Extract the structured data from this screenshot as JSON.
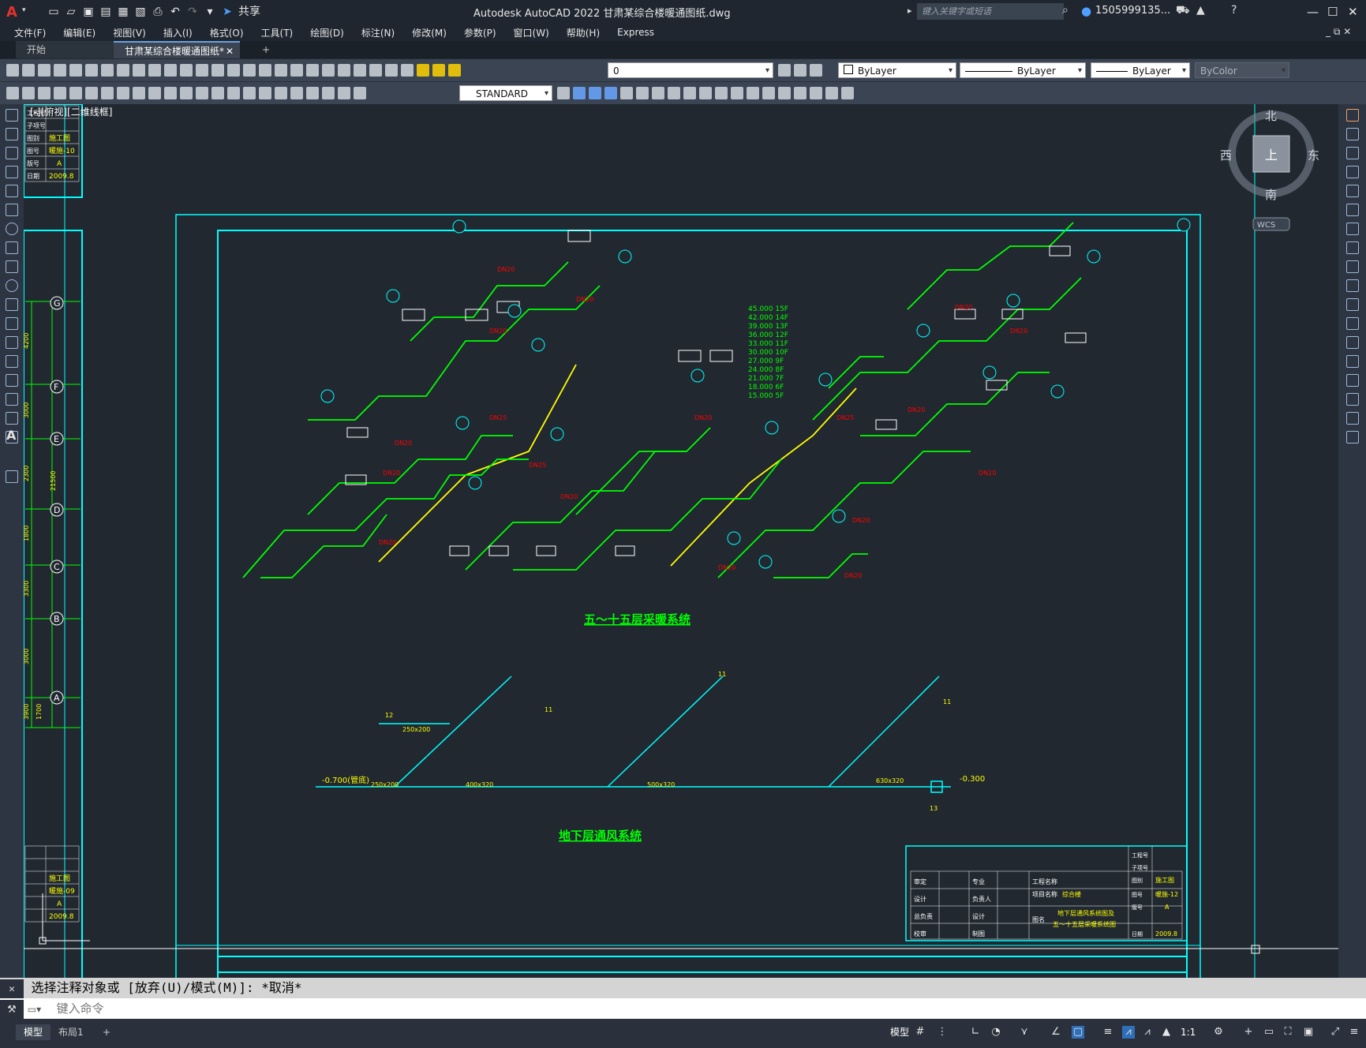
{
  "app": {
    "logo": "A",
    "title": "Autodesk AutoCAD 2022    甘肃某综合楼暖通图纸.dwg",
    "search_placeholder": "键入关键字或短语",
    "user": "1505999135...",
    "share_label": "共享"
  },
  "menu": [
    "文件(F)",
    "编辑(E)",
    "视图(V)",
    "插入(I)",
    "格式(O)",
    "工具(T)",
    "绘图(D)",
    "标注(N)",
    "修改(M)",
    "参数(P)",
    "窗口(W)",
    "帮助(H)",
    "Express"
  ],
  "tabs": {
    "start": "开始",
    "drawing": "甘肃某综合楼暖通图纸*",
    "add": "+"
  },
  "toolbar": {
    "layer_value": "0",
    "color": "ByLayer",
    "linetype": "ByLayer",
    "lineweight": "ByLayer",
    "plotstyle": "ByColor",
    "textstyle": "STANDARD"
  },
  "viewport": {
    "label": "[-][俯视][二维线框]"
  },
  "viewcube": {
    "north": "北",
    "south": "南",
    "east": "东",
    "west": "西",
    "face": "上",
    "wcs": "WCS"
  },
  "drawing": {
    "heating_title": "五～十五层采暖系统",
    "vent_title": "地下层通风系统",
    "levels": [
      "45.000 15F",
      "42.000 14F",
      "39.000 13F",
      "36.000 12F",
      "33.000 11F",
      "30.000 10F",
      "27.000 9F",
      "24.000 8F",
      "21.000 7F",
      "18.000 6F",
      "15.000 5F"
    ],
    "axis_labels": [
      "G",
      "F",
      "E",
      "D",
      "C",
      "B",
      "A"
    ],
    "axis_dims": [
      "4200",
      "3000",
      "2300",
      "1800",
      "3300",
      "3000",
      "3900",
      "1700"
    ],
    "total_dim": "21500",
    "elev_left": "-0.700(管底)",
    "elev_right": "-0.300",
    "titleblock_top": {
      "rows": [
        "工程号",
        "子项号",
        "图别",
        "图号",
        "版号",
        "日期"
      ],
      "vals": [
        "",
        "",
        "施工图",
        "暖施-10",
        "A",
        "2009.8"
      ]
    },
    "titleblock_mid": {
      "vals": [
        "",
        "",
        "施工图",
        "暖施-09",
        "A",
        "2009.8"
      ]
    },
    "titleblock_main": {
      "left": [
        "审定",
        "设计",
        "总负责",
        "校审"
      ],
      "mid": [
        "专业",
        "负责人",
        "设计",
        "制图"
      ],
      "project_label": "工程名称",
      "item_label": "项目名称",
      "item_value": "综合楼",
      "drawing_label": "图名",
      "drawing_name_1": "地下层通风系统图及",
      "drawing_name_2": "五～十五层采暖系统图",
      "right_rows": [
        "工程号",
        "子项号",
        "图别",
        "图号",
        "版号",
        "日期"
      ],
      "right_vals": [
        "",
        "",
        "施工图",
        "暖施-12",
        "A",
        "2009.8"
      ]
    }
  },
  "command": {
    "history": "选择注释对象或 [放弃(U)/模式(M)]: *取消*",
    "placeholder": "键入命令"
  },
  "status": {
    "model_tab": "模型",
    "layout_tab": "布局1",
    "model_label": "模型",
    "scale": "1:1"
  },
  "colors": {
    "cyan": "#00ffff",
    "green": "#00ff00",
    "yellow": "#ffff00",
    "red": "#ff0000",
    "bg": "#212830"
  }
}
